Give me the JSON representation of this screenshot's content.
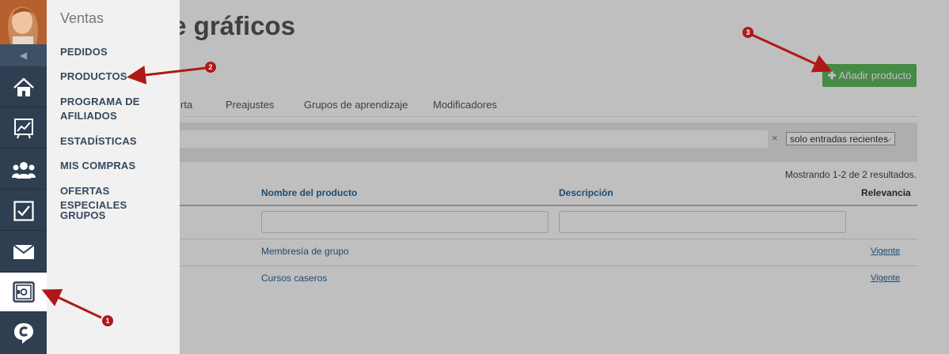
{
  "main": {
    "title": "de gráficos",
    "add_button_label": "Añadir producto",
    "tabs": [
      "rta",
      "Preajustes",
      "Grupos de aprendizaje",
      "Modificadores"
    ],
    "filter": {
      "select_value": "solo entradas recientes",
      "clear": "×"
    },
    "results_text": "Mostrando 1-2 de 2 resultados.",
    "table": {
      "headers": {
        "name": "Nombre del producto",
        "description": "Descripción",
        "relevance": "Relevancia"
      },
      "rows": [
        {
          "name": "Membresía de grupo",
          "relevance": "Vigente"
        },
        {
          "name": "Cursos caseros",
          "relevance": "Vigente"
        }
      ]
    }
  },
  "rail": {
    "items": [
      "home-icon",
      "stats-chart-icon",
      "users-icon",
      "checkbox-icon",
      "mail-icon",
      "safe-icon",
      "chat-logo-icon"
    ],
    "colors": {
      "background": "#2f3e51",
      "collapse": "#3c5066"
    }
  },
  "panel": {
    "title": "Ventas",
    "items": [
      "PEDIDOS",
      "PRODUCTOS",
      "PROGRAMA DE AFILIADOS",
      "ESTADÍSTICAS",
      "MIS COMPRAS",
      "OFERTAS ESPECIALES",
      "GRUPOS"
    ]
  },
  "annotations": {
    "badges": [
      "1",
      "2",
      "3"
    ],
    "color": "#b01818"
  }
}
